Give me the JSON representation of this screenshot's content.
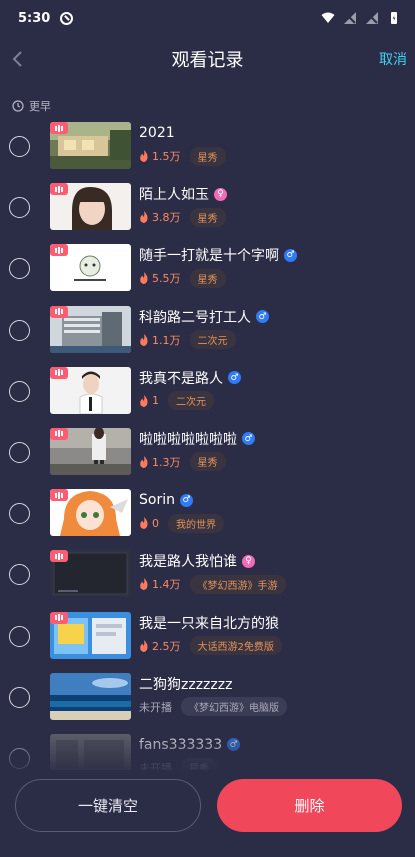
{
  "status_bar": {
    "time": "5:30"
  },
  "nav": {
    "title": "观看记录",
    "cancel_label": "取消"
  },
  "section": {
    "label": "更早"
  },
  "records": [
    {
      "name": "2021",
      "gender": "",
      "live": true,
      "heat": "1.5万",
      "tag": "星秀",
      "thumb": "thumb-house"
    },
    {
      "name": "陌上人如玉",
      "gender": "female",
      "live": true,
      "heat": "3.8万",
      "tag": "星秀",
      "thumb": "thumb-portrait"
    },
    {
      "name": "随手一打就是十个字啊",
      "gender": "male",
      "live": true,
      "heat": "5.5万",
      "tag": "星秀",
      "thumb": "thumb-logo"
    },
    {
      "name": "科韵路二号打工人",
      "gender": "male",
      "live": true,
      "heat": "1.1万",
      "tag": "二次元",
      "thumb": "thumb-building"
    },
    {
      "name": "我真不是路人",
      "gender": "male",
      "live": true,
      "heat": "1",
      "tag": "二次元",
      "thumb": "thumb-person"
    },
    {
      "name": "啦啦啦啦啦啦啦",
      "gender": "male",
      "live": true,
      "heat": "1.3万",
      "tag": "星秀",
      "thumb": "thumb-street"
    },
    {
      "name": "Sorin",
      "gender": "male",
      "live": true,
      "heat": "0",
      "tag": "我的世界",
      "thumb": "thumb-anime"
    },
    {
      "name": "我是路人我怕谁",
      "gender": "female",
      "live": true,
      "heat": "1.4万",
      "tag": "《梦幻西游》手游",
      "thumb": "thumb-dark"
    },
    {
      "name": "我是一只来自北方的狼",
      "gender": "",
      "live": true,
      "heat": "2.5万",
      "tag": "大话西游2免费版",
      "thumb": "thumb-screen"
    },
    {
      "name": "二狗狗zzzzzzz",
      "gender": "",
      "live": false,
      "heat": "未开播",
      "tag": "《梦幻西游》电脑版",
      "thumb": "thumb-sea"
    },
    {
      "name": "fans333333",
      "gender": "male",
      "live": false,
      "heat": "未开播",
      "tag": "星秀",
      "thumb": "thumb-text"
    }
  ],
  "actions": {
    "clear_all": "一键清空",
    "delete": "删除"
  },
  "colors": {
    "background": "#2b2c45",
    "accent": "#3fd1f0",
    "delete": "#f0475a",
    "badge": "#ff5b72"
  }
}
